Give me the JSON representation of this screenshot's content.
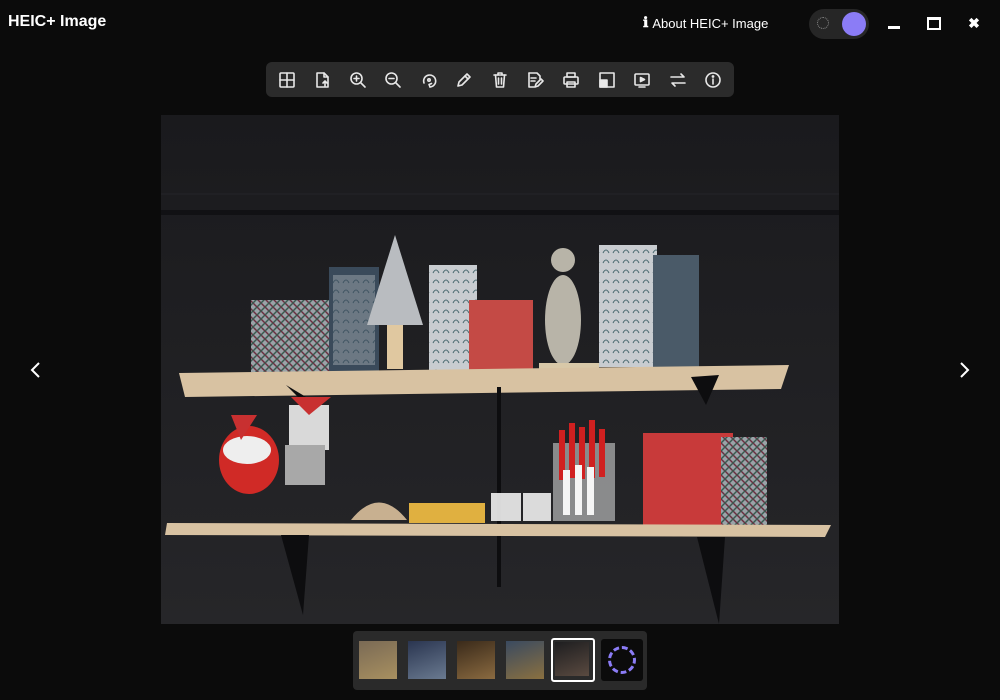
{
  "window": {
    "title": "HEIC+ Image",
    "about_label": "About HEIC+ Image",
    "minimize": "minimize",
    "maximize": "maximize",
    "close": "close"
  },
  "theme": {
    "mode": "dark",
    "accent": "#8b7cf6"
  },
  "toolbar": {
    "tools": [
      {
        "name": "grid-view-icon"
      },
      {
        "name": "export-file-icon"
      },
      {
        "name": "zoom-in-icon"
      },
      {
        "name": "zoom-out-icon"
      },
      {
        "name": "rotate-icon"
      },
      {
        "name": "edit-pencil-icon"
      },
      {
        "name": "delete-trash-icon"
      },
      {
        "name": "rename-icon"
      },
      {
        "name": "print-icon"
      },
      {
        "name": "set-wallpaper-icon"
      },
      {
        "name": "slideshow-icon"
      },
      {
        "name": "convert-swap-icon"
      },
      {
        "name": "info-icon"
      }
    ]
  },
  "viewer": {
    "prev_icon": "chevron-left-icon",
    "next_icon": "chevron-right-icon",
    "image_subject": "shelves-christmas-decor"
  },
  "thumbnails": [
    {
      "name": "thumb-1",
      "colors": [
        "#7a6a55",
        "#a89060"
      ]
    },
    {
      "name": "thumb-2",
      "colors": [
        "#2a3550",
        "#6a7a90"
      ]
    },
    {
      "name": "thumb-3",
      "colors": [
        "#3a2a1a",
        "#8a6a40"
      ]
    },
    {
      "name": "thumb-4",
      "colors": [
        "#3a4a60",
        "#8a7040"
      ]
    },
    {
      "name": "thumb-5",
      "colors": [
        "#1e1e20",
        "#5a4a40"
      ],
      "active": true
    },
    {
      "name": "thumb-loading",
      "loading": true
    }
  ]
}
